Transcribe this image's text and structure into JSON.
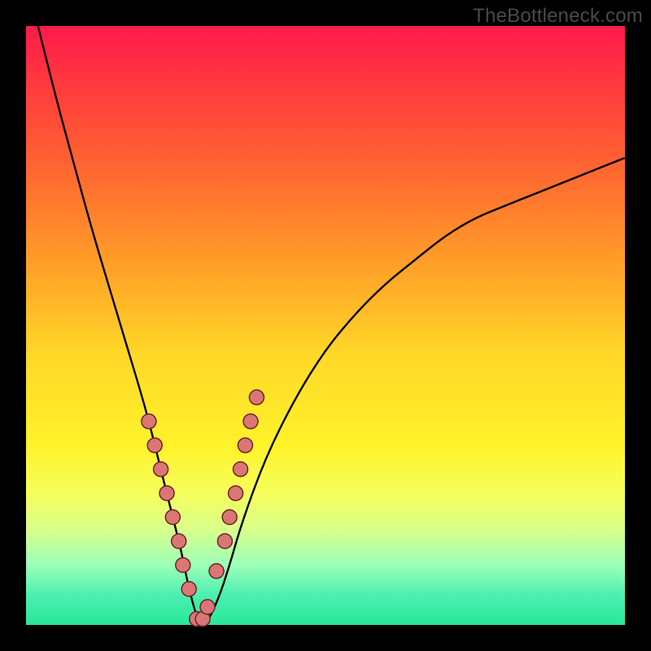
{
  "watermark": "TheBottleneck.com",
  "colors": {
    "frame_background": "#000000",
    "gradient_top": "#ff1a4b",
    "gradient_bottom": "#27e79a",
    "curve_stroke": "#000000",
    "dot_fill": "#db7676",
    "dot_stroke": "#6d2424"
  },
  "chart_data": {
    "type": "line",
    "title": "",
    "xlabel": "",
    "ylabel": "",
    "xlim": [
      0,
      100
    ],
    "ylim": [
      0,
      100
    ],
    "grid": false,
    "legend": false,
    "series": [
      {
        "name": "bottleneck-curve",
        "x": [
          2,
          5,
          8,
          11,
          14,
          17,
          20,
          22,
          24,
          26,
          27,
          28,
          29,
          30,
          32,
          34,
          36,
          40,
          45,
          50,
          55,
          60,
          65,
          70,
          75,
          80,
          85,
          90,
          95,
          100
        ],
        "y": [
          100,
          88,
          77,
          66,
          56,
          46,
          36,
          28,
          20,
          12,
          7,
          3,
          0,
          0,
          4,
          10,
          17,
          28,
          38,
          46,
          52,
          57,
          61,
          65,
          68,
          70,
          72,
          74,
          76,
          78
        ]
      }
    ],
    "markers": {
      "name": "sample-dots",
      "x": [
        20.5,
        21.5,
        22.5,
        23.5,
        24.5,
        25.5,
        26.2,
        27.2,
        28.5,
        29.5,
        30.3,
        31.8,
        33.2,
        34.0,
        35.0,
        35.8,
        36.6,
        37.5,
        38.5
      ],
      "y": [
        34,
        30,
        26,
        22,
        18,
        14,
        10,
        6,
        1,
        1,
        3,
        9,
        14,
        18,
        22,
        26,
        30,
        34,
        38
      ]
    }
  }
}
